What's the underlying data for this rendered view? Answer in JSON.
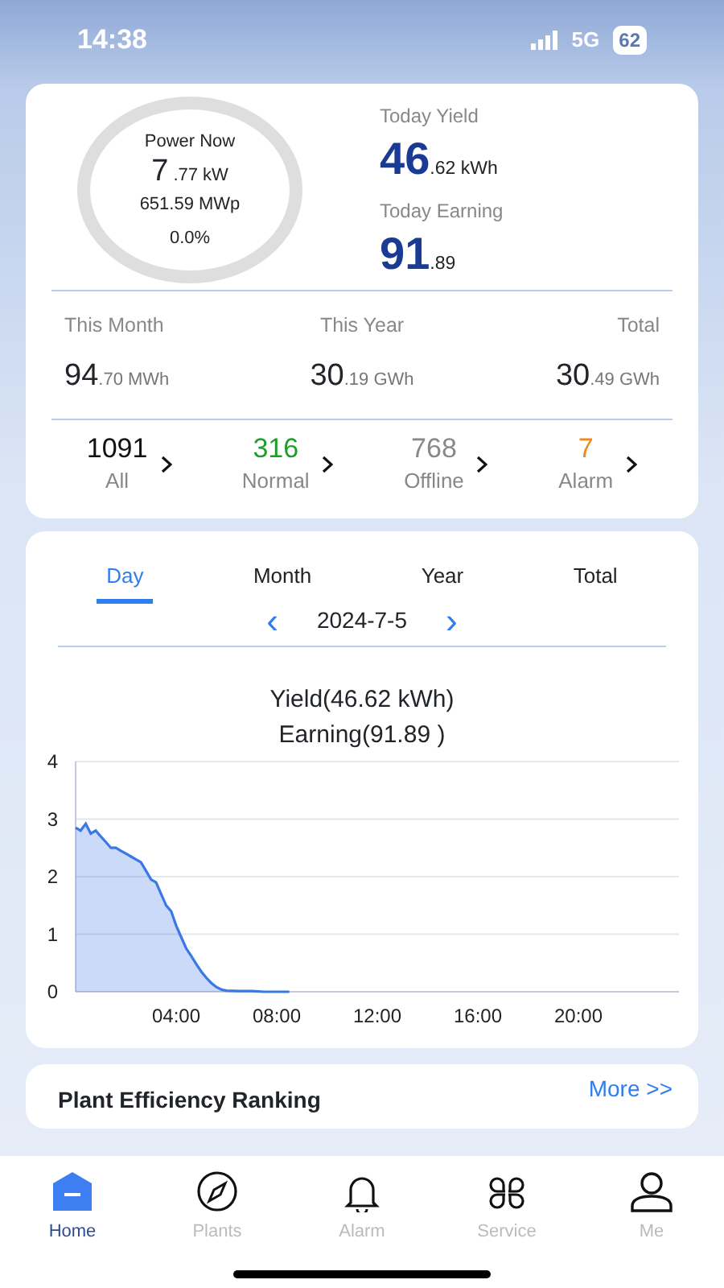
{
  "status_bar": {
    "time": "14:38",
    "network": "5G",
    "battery": "62"
  },
  "summary": {
    "power_label": "Power Now",
    "power_int": "7",
    "power_frac": ".77 kW",
    "capacity": "651.59 MWp",
    "ratio": "0.0%",
    "yield_label": "Today Yield",
    "yield_int": "46",
    "yield_frac": ".62 kWh",
    "earning_label": "Today Earning",
    "earning_int": "91",
    "earning_frac": ".89",
    "periods": [
      {
        "label": "This Month",
        "int": "94",
        "frac": ".70 MWh"
      },
      {
        "label": "This Year",
        "int": "30",
        "frac": ".19 GWh"
      },
      {
        "label": "Total",
        "int": "30",
        "frac": ".49 GWh"
      }
    ],
    "statuses": [
      {
        "count": "1091",
        "label": "All",
        "color": "#111111"
      },
      {
        "count": "316",
        "label": "Normal",
        "color": "#1f9d2a"
      },
      {
        "count": "768",
        "label": "Offline",
        "color": "#888888"
      },
      {
        "count": "7",
        "label": "Alarm",
        "color": "#f0891c"
      }
    ]
  },
  "chart_card": {
    "tabs": [
      {
        "label": "Day",
        "selected": true
      },
      {
        "label": "Month",
        "selected": false
      },
      {
        "label": "Year",
        "selected": false
      },
      {
        "label": "Total",
        "selected": false
      }
    ],
    "date": "2024-7-5",
    "prev": "‹",
    "next": "›",
    "yield_text": "Yield(46.62 kWh)",
    "earning_text": "Earning(91.89 )",
    "chart_data": {
      "type": "area",
      "grid": true,
      "x": [
        0,
        0.2,
        0.4,
        0.6,
        0.8,
        1,
        1.2,
        1.4,
        1.6,
        1.8,
        2,
        2.2,
        2.4,
        2.6,
        2.8,
        3,
        3.2,
        3.4,
        3.6,
        3.8,
        4,
        4.2,
        4.4,
        4.6,
        4.8,
        5,
        5.2,
        5.4,
        5.6,
        5.8,
        6,
        6.5,
        7,
        7.5,
        8,
        8.5
      ],
      "series": [
        {
          "color": "#3a78e6",
          "values": [
            2.85,
            2.8,
            2.92,
            2.75,
            2.8,
            2.7,
            2.6,
            2.5,
            2.5,
            2.45,
            2.4,
            2.35,
            2.3,
            2.25,
            2.1,
            1.95,
            1.9,
            1.7,
            1.5,
            1.4,
            1.15,
            0.95,
            0.75,
            0.62,
            0.48,
            0.35,
            0.24,
            0.15,
            0.08,
            0.04,
            0.02,
            0.01,
            0.01,
            0,
            0,
            0
          ]
        }
      ],
      "xlim": [
        0,
        24
      ],
      "ylim": [
        0,
        4
      ],
      "yticks": [
        0,
        1,
        2,
        3,
        4
      ],
      "xticks": [
        {
          "value": 4,
          "label": "04:00"
        },
        {
          "value": 8,
          "label": "08:00"
        },
        {
          "value": 12,
          "label": "12:00"
        },
        {
          "value": 16,
          "label": "16:00"
        },
        {
          "value": 20,
          "label": "20:00"
        }
      ]
    }
  },
  "ranking": {
    "title": "Plant Efficiency Ranking",
    "more": "More >>"
  },
  "tab_bar": [
    {
      "label": "Home",
      "selected": true
    },
    {
      "label": "Plants",
      "selected": false
    },
    {
      "label": "Alarm",
      "selected": false
    },
    {
      "label": "Service",
      "selected": false
    },
    {
      "label": "Me",
      "selected": false
    }
  ]
}
